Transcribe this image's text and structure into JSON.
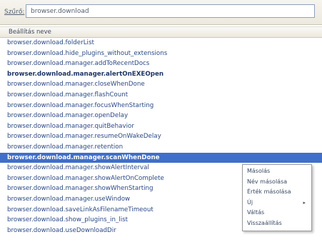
{
  "filter": {
    "label": "Szűrő:",
    "value": "browser.download"
  },
  "columns": {
    "preference_name": "Beállítás neve"
  },
  "rows": [
    {
      "name": "browser.download.folderList"
    },
    {
      "name": "browser.download.hide_plugins_without_extensions"
    },
    {
      "name": "browser.download.manager.addToRecentDocs"
    },
    {
      "name": "browser.download.manager.alertOnEXEOpen",
      "modified": true
    },
    {
      "name": "browser.download.manager.closeWhenDone"
    },
    {
      "name": "browser.download.manager.flashCount"
    },
    {
      "name": "browser.download.manager.focusWhenStarting"
    },
    {
      "name": "browser.download.manager.openDelay"
    },
    {
      "name": "browser.download.manager.quitBehavior"
    },
    {
      "name": "browser.download.manager.resumeOnWakeDelay"
    },
    {
      "name": "browser.download.manager.retention"
    },
    {
      "name": "browser.download.manager.scanWhenDone",
      "modified": true,
      "selected": true
    },
    {
      "name": "browser.download.manager.showAlertInterval"
    },
    {
      "name": "browser.download.manager.showAlertOnComplete"
    },
    {
      "name": "browser.download.manager.showWhenStarting"
    },
    {
      "name": "browser.download.manager.useWindow"
    },
    {
      "name": "browser.download.saveLinkAsFilenameTimeout"
    },
    {
      "name": "browser.download.show_plugins_in_list"
    },
    {
      "name": "browser.download.useDownloadDir"
    }
  ],
  "context_menu": {
    "items": [
      {
        "label": "Másolás"
      },
      {
        "label": "Név másolása"
      },
      {
        "label": "Érték másolása"
      },
      {
        "label": "Új",
        "submenu": true
      },
      {
        "label": "Váltás"
      },
      {
        "label": "Visszaállítás"
      }
    ],
    "submenu_arrow": "▸"
  }
}
